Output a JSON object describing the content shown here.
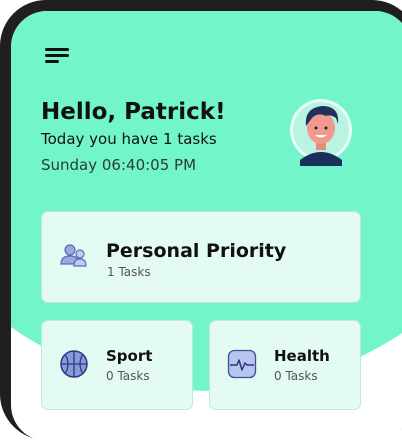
{
  "header": {
    "menu_icon": "hamburger-menu-icon",
    "greeting": "Hello, Patrick!",
    "subtitle": "Today you have 1 tasks",
    "datetime": "Sunday 06:40:05 PM",
    "avatar_icon": "user-avatar-icon"
  },
  "categories": [
    {
      "title": "Personal Priority",
      "count_label": "1 Tasks",
      "icon": "people-icon"
    },
    {
      "title": "Sport",
      "count_label": "0 Tasks",
      "icon": "basketball-icon"
    },
    {
      "title": "Health",
      "count_label": "0 Tasks",
      "icon": "heart-monitor-icon"
    }
  ],
  "colors": {
    "background_accent": "#73f5cc",
    "card_background": "#e3fbf3",
    "icon_color": "#7b8fd4"
  }
}
